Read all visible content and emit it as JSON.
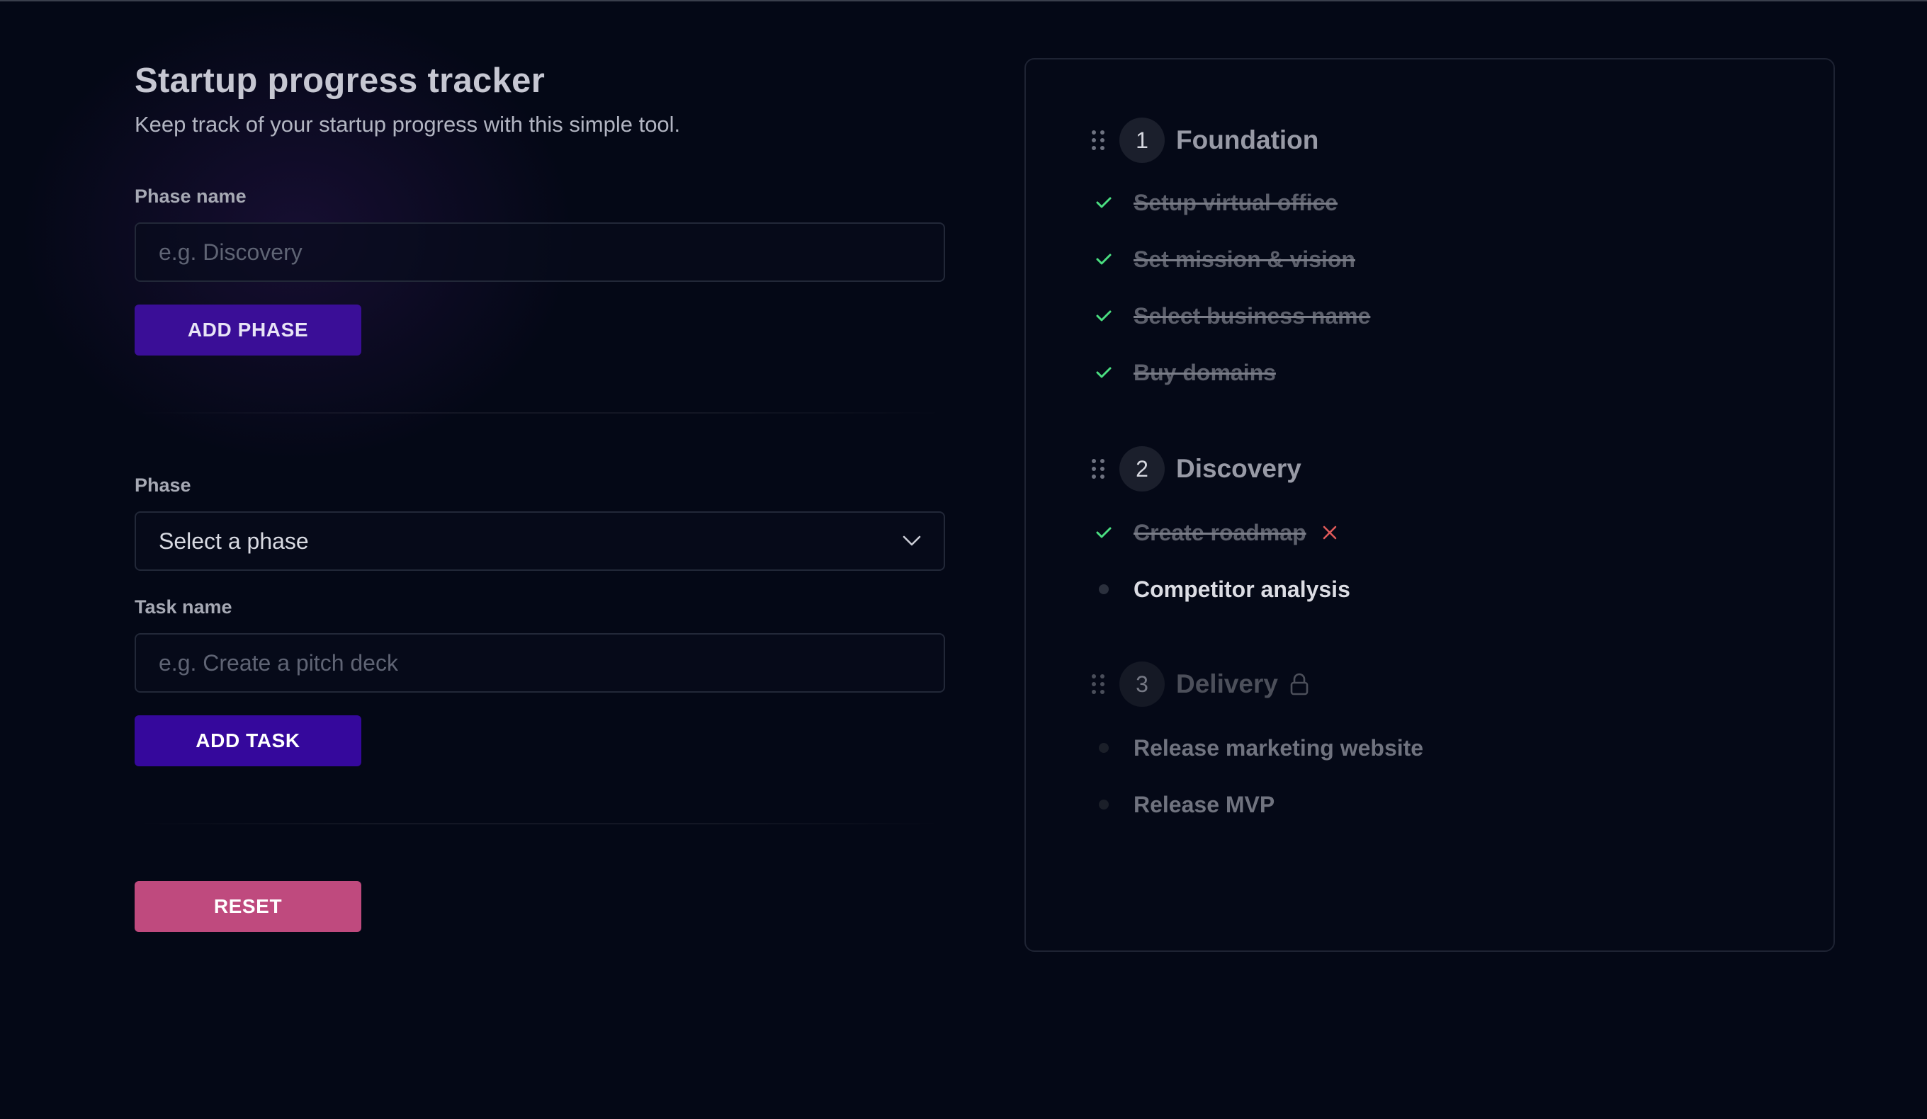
{
  "header": {
    "title": "Startup progress tracker",
    "subtitle": "Keep track of your startup progress with this simple tool."
  },
  "phase_form": {
    "label": "Phase name",
    "placeholder": "e.g. Discovery",
    "button": "ADD PHASE"
  },
  "task_form": {
    "phase_label": "Phase",
    "phase_select_value": "Select a phase",
    "task_label": "Task name",
    "task_placeholder": "e.g. Create a pitch deck",
    "button": "ADD TASK"
  },
  "reset_button": "RESET",
  "phases": [
    {
      "number": "1",
      "name": "Foundation",
      "locked": false,
      "tasks": [
        {
          "name": "Setup virtual office",
          "done": true
        },
        {
          "name": "Set mission & vision",
          "done": true
        },
        {
          "name": "Select business name",
          "done": true
        },
        {
          "name": "Buy domains",
          "done": true
        }
      ]
    },
    {
      "number": "2",
      "name": "Discovery",
      "locked": false,
      "tasks": [
        {
          "name": "Create roadmap",
          "done": true
        },
        {
          "name": "Competitor analysis",
          "done": false
        }
      ]
    },
    {
      "number": "3",
      "name": "Delivery",
      "locked": true,
      "tasks": [
        {
          "name": "Release marketing website",
          "done": false
        },
        {
          "name": "Release MVP",
          "done": false
        }
      ]
    }
  ],
  "colors": {
    "background": "#040816",
    "accent": "#3a0e97",
    "reset": "#bf4a7e",
    "check": "#4ade80",
    "remove": "#e05a5a"
  },
  "icons": {
    "phase_drag": "grip-dots-icon",
    "task_done": "check-icon",
    "task_pending": "dot-icon",
    "remove_task": "close-icon",
    "locked_phase": "lock-icon",
    "select": "chevron-down-icon"
  }
}
